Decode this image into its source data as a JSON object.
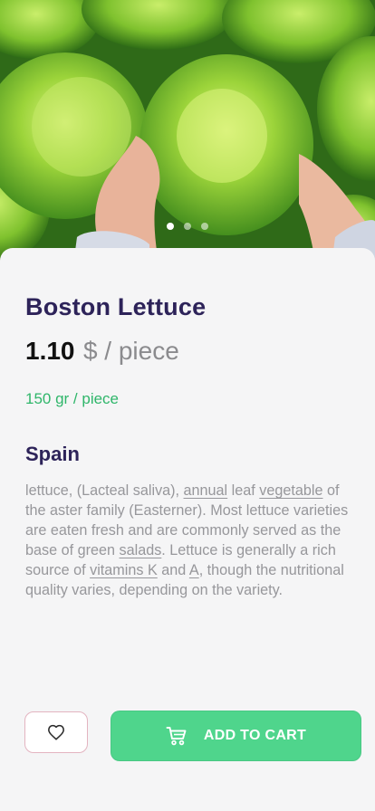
{
  "hero": {
    "image": "lettuce-photo",
    "carousel": {
      "count": 3,
      "active_index": 0
    }
  },
  "product": {
    "name": "Boston Lettuce",
    "price": "1.10",
    "price_unit": "$ / piece",
    "weight": "150 gr / piece",
    "origin": "Spain",
    "description": {
      "t1": "lettuce, (Lacteal saliva), ",
      "l1": "annual",
      "t2": " leaf ",
      "l2": "vegetable",
      "t3": " of the aster family (Easterner). Most lettuce varieties are eaten fresh and are commonly served as the base of green ",
      "l3": "salads",
      "t4": ". Lettuce is generally a rich source of ",
      "l4": "vitamins K",
      "t5": " and ",
      "l5": "A",
      "t6": ", though the nutritional quality varies, depending on the variety."
    }
  },
  "actions": {
    "favorite_icon": "heart-icon",
    "cart_icon": "cart-icon",
    "add_to_cart_label": "ADD TO CART"
  },
  "colors": {
    "title": "#2d2359",
    "accent_green": "#4fd58c",
    "weight_green": "#2fb66a",
    "body_text": "#97979b",
    "favorite_border": "#e3b4c0"
  }
}
